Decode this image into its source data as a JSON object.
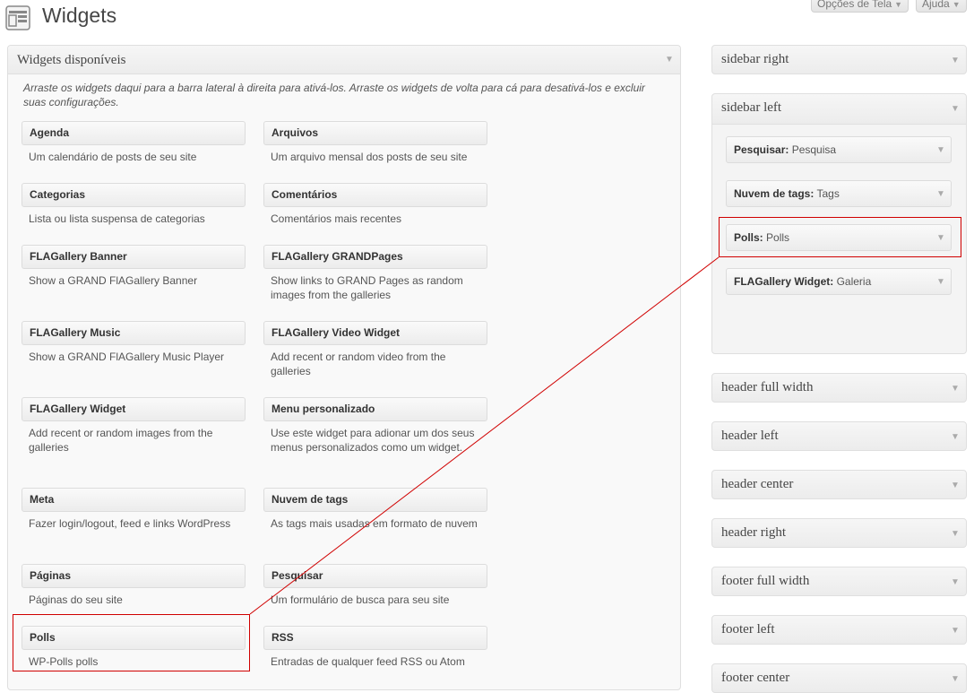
{
  "header": {
    "title": "Widgets",
    "screen_options_label": "Opções de Tela",
    "help_label": "Ajuda",
    "icon": "widgets-icon"
  },
  "available": {
    "title": "Widgets disponíveis",
    "description": "Arraste os widgets daqui para a barra lateral à direita para ativá-los. Arraste os widgets de volta para cá para desativá-los e excluir suas configurações.",
    "widgets": [
      {
        "title": "Agenda",
        "desc": "Um calendário de posts de seu site"
      },
      {
        "title": "Arquivos",
        "desc": "Um arquivo mensal dos posts de seu site"
      },
      {
        "title": "Categorias",
        "desc": "Lista ou lista suspensa de categorias"
      },
      {
        "title": "Comentários",
        "desc": "Comentários mais recentes"
      },
      {
        "title": "FLAGallery Banner",
        "desc": "Show a GRAND FlAGallery Banner"
      },
      {
        "title": "FLAGallery GRANDPages",
        "desc": "Show links to GRAND Pages as random images from the galleries"
      },
      {
        "title": "FLAGallery Music",
        "desc": "Show a GRAND FlAGallery Music Player"
      },
      {
        "title": "FLAGallery Video Widget",
        "desc": "Add recent or random video from the galleries"
      },
      {
        "title": "FLAGallery Widget",
        "desc": "Add recent or random images from the galleries"
      },
      {
        "title": "Menu personalizado",
        "desc": "Use este widget para adionar um dos seus menus personalizados como um widget."
      },
      {
        "title": "Meta",
        "desc": "Fazer login/logout, feed e links WordPress"
      },
      {
        "title": "Nuvem de tags",
        "desc": "As tags mais usadas em formato de nuvem"
      },
      {
        "title": "Páginas",
        "desc": "Páginas do seu site"
      },
      {
        "title": "Pesquisar",
        "desc": "Um formulário de busca para seu site"
      },
      {
        "title": "Polls",
        "desc": "WP-Polls polls"
      },
      {
        "title": "RSS",
        "desc": "Entradas de qualquer feed RSS ou Atom"
      }
    ]
  },
  "sidebars": {
    "sidebar_right": "sidebar right",
    "sidebar_left": "sidebar left",
    "sidebar_left_widgets": [
      {
        "type": "Pesquisar:",
        "name": "Pesquisa"
      },
      {
        "type": "Nuvem de tags:",
        "name": "Tags"
      },
      {
        "type": "Polls:",
        "name": "Polls"
      },
      {
        "type": "FLAGallery Widget:",
        "name": "Galeria"
      }
    ],
    "others": [
      "header full width",
      "header left",
      "header center",
      "header right",
      "footer full width",
      "footer left",
      "footer center"
    ]
  },
  "colors": {
    "highlight": "#d00000",
    "accent": "#464646"
  }
}
